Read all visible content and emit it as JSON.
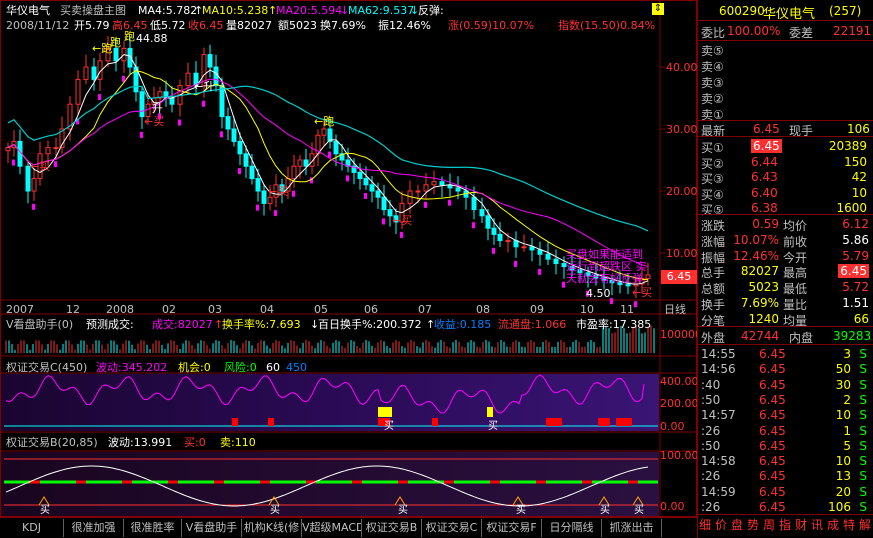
{
  "header": {
    "stock_name": "华仪电气",
    "mode": "买卖操盘主图",
    "ma": [
      {
        "label": "MA4:5.782",
        "color": "#ffffff"
      },
      {
        "label": "MA10:5.238",
        "color": "#ffff00"
      },
      {
        "label": "MA20:5.594",
        "color": "#ff00ff"
      },
      {
        "label": "MA62:9.537",
        "color": "#00ffff"
      },
      {
        "label": "反弹:",
        "color": "#ffffff"
      }
    ],
    "ma_arrows": [
      "↑",
      "↑",
      "↓",
      "↓"
    ],
    "row2_date": "2008/11/12",
    "row2_open": "开5.79",
    "row2_high": "高6.45",
    "row2_low": "低5.72",
    "row2_close": "收6.45",
    "row2_vol": "量82027",
    "row2_amt": "额5023",
    "row2_turn": "换7.69%",
    "row2_amp": "振12.46%",
    "row2_chg": "涨(0.59)10.07%",
    "row2_index": "指数(15.50)0.84%"
  },
  "price_axis": [
    "40.00",
    "30.00",
    "20.00",
    "10.00"
  ],
  "price_label_current": "6.45",
  "price_label_low": "4.50",
  "price_label_high": "44.88",
  "date_axis": [
    "2007",
    "12",
    "2008",
    "02",
    "03",
    "04",
    "05",
    "06",
    "07",
    "08",
    "09",
    "10",
    "11"
  ],
  "date_axis_right": "日线",
  "chart_signals": [
    {
      "text": "←跑",
      "color": "#ffff00"
    },
    {
      "text": "跑",
      "color": "#ffff00"
    },
    {
      "text": "跑",
      "color": "#ffff00"
    },
    {
      "text": "←跑",
      "color": "#ffff00"
    },
    {
      "text": "升",
      "color": "#ffffff"
    },
    {
      "text": "←升",
      "color": "#ffffff"
    },
    {
      "text": "←买",
      "color": "#ff3030"
    },
    {
      "text": "←买",
      "color": "#ff3030"
    },
    {
      "text": "←买",
      "color": "#ff3030"
    },
    {
      "text": "←买",
      "color": "#ff3030"
    },
    {
      "text": "←买",
      "color": "#ff3030"
    }
  ],
  "chart_overlay_text": [
    "买盘如果能适到",
    "运行到超跌区 实",
    "天就会有好反弹"
  ],
  "vol_panel": {
    "title": "V看盘助手(0)",
    "predict": "预测成交:",
    "vol": "成交:82027",
    "turn": "换手率%:7.693",
    "hundred": "百日换手%:200.372",
    "income": "收益:0.185",
    "float": "流通盘:1.066",
    "pe": "市盈率:17.385",
    "axis": "100000",
    "arrows": [
      "↑",
      "↓",
      "↑"
    ]
  },
  "indc_panel": {
    "title": "权证交易C(450)",
    "wave": "波动:345.202",
    "chance": "机会:0",
    "risk": "风险:0",
    "v60": "60",
    "v450": "450",
    "axis": [
      "400.00",
      "200.00",
      "0.00"
    ],
    "marks": [
      "买",
      "买"
    ]
  },
  "indb_panel": {
    "title": "权证交易B(20,85)",
    "wave": "波动:13.991",
    "buy": "买:0",
    "sell": "卖:110",
    "axis": [
      "100.00",
      "0.00"
    ],
    "marks": [
      "买",
      "买",
      "买",
      "买",
      "买",
      "买"
    ]
  },
  "tabs": [
    "KDJ",
    "很准加强",
    "很准胜率",
    "V看盘助手",
    "机构K线(修",
    "V超级MACD",
    "权证交易B",
    "权证交易C",
    "权证交易F",
    "日分隔线",
    "抓涨出击"
  ],
  "quote": {
    "code": "600290",
    "name": "华仪电气",
    "num": "(257)",
    "weibi_label": "委比",
    "weibi": "100.00%",
    "weicha_label": "委差",
    "weicha": "22191",
    "sells": [
      "卖⑤",
      "卖④",
      "卖③",
      "卖②",
      "卖①"
    ],
    "latest_label": "最新",
    "latest": "6.45",
    "xianshou_label": "现手",
    "xianshou": "106",
    "buys": [
      {
        "label": "买①",
        "price": "6.45",
        "vol": "20389"
      },
      {
        "label": "买②",
        "price": "6.44",
        "vol": "150"
      },
      {
        "label": "买③",
        "price": "6.43",
        "vol": "42"
      },
      {
        "label": "买④",
        "price": "6.40",
        "vol": "10"
      },
      {
        "label": "买⑤",
        "price": "6.38",
        "vol": "1600"
      }
    ],
    "stats": [
      {
        "l1": "涨跌",
        "v1": "0.59",
        "l2": "均价",
        "v2": "6.12"
      },
      {
        "l1": "涨幅",
        "v1": "10.07%",
        "l2": "前收",
        "v2": "5.86"
      },
      {
        "l1": "振幅",
        "v1": "12.46%",
        "l2": "今开",
        "v2": "5.79"
      },
      {
        "l1": "总手",
        "v1": "82027",
        "l2": "最高",
        "v2": "6.45"
      },
      {
        "l1": "总额",
        "v1": "5023",
        "l2": "最低",
        "v2": "5.72"
      },
      {
        "l1": "换手",
        "v1": "7.69%",
        "l2": "量比",
        "v2": "1.51"
      },
      {
        "l1": "分笔",
        "v1": "1240",
        "l2": "均量",
        "v2": "66"
      }
    ],
    "waipan_label": "外盘",
    "waipan": "42744",
    "neipan_label": "内盘",
    "neipan": "39283",
    "ticks": [
      {
        "t": "14:55",
        "p": "6.45",
        "v": "3",
        "s": "S"
      },
      {
        "t": "14:56",
        "p": "6.45",
        "v": "50",
        "s": "S"
      },
      {
        "t": ":40",
        "p": "6.45",
        "v": "30",
        "s": "S"
      },
      {
        "t": ":50",
        "p": "6.45",
        "v": "2",
        "s": "S"
      },
      {
        "t": "14:57",
        "p": "6.45",
        "v": "10",
        "s": "S"
      },
      {
        "t": ":26",
        "p": "6.45",
        "v": "1",
        "s": "S"
      },
      {
        "t": ":50",
        "p": "6.45",
        "v": "5",
        "s": "S"
      },
      {
        "t": "14:58",
        "p": "6.45",
        "v": "10",
        "s": "S"
      },
      {
        "t": ":26",
        "p": "6.45",
        "v": "13",
        "s": "S"
      },
      {
        "t": "14:59",
        "p": "6.45",
        "v": "20",
        "s": "S"
      },
      {
        "t": ":26",
        "p": "6.45",
        "v": "106",
        "s": "S"
      }
    ],
    "right_tabs": [
      "细",
      "价",
      "盘",
      "势",
      "周",
      "指",
      "财",
      "讯",
      "成",
      "特",
      "解"
    ]
  },
  "colors": {
    "up": "#ff3030",
    "down": "#00ffff",
    "frame": "#800000",
    "yellow": "#ffff00",
    "magenta": "#ff00ff"
  }
}
